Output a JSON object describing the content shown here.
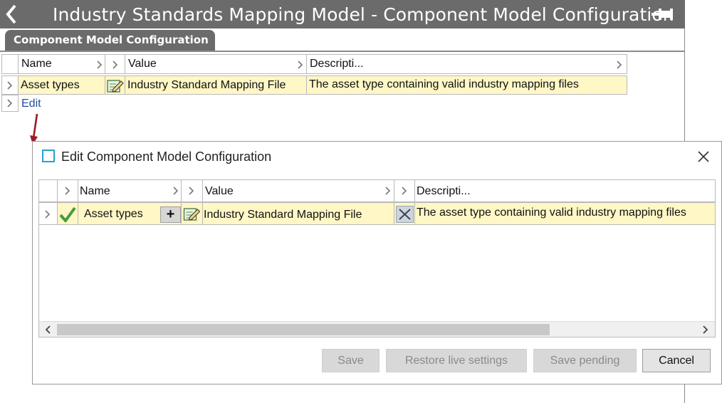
{
  "window": {
    "title": "Industry Standards Mapping Model - Component Model Configuration",
    "tab_label": "Component Model Configuration"
  },
  "main_grid": {
    "columns": [
      "Name",
      "Value",
      "Descripti..."
    ],
    "rows": [
      {
        "name": "Asset types",
        "value": "Industry Standard Mapping File",
        "description": "The asset type containing valid industry mapping files"
      }
    ],
    "edit_link": "Edit"
  },
  "dialog": {
    "title": "Edit Component Model Configuration",
    "columns": [
      "Name",
      "Value",
      "Descripti..."
    ],
    "rows": [
      {
        "name": "Asset types",
        "value": "Industry Standard Mapping File",
        "description": "The asset type containing valid industry mapping files"
      }
    ],
    "buttons": {
      "save": "Save",
      "restore": "Restore live settings",
      "save_pending": "Save pending",
      "cancel": "Cancel"
    }
  },
  "colors": {
    "title_bar": "#6b6b6b",
    "row_highlight": "#fff7c6",
    "link": "#1d4ea1",
    "arrow": "#9b1c24"
  }
}
